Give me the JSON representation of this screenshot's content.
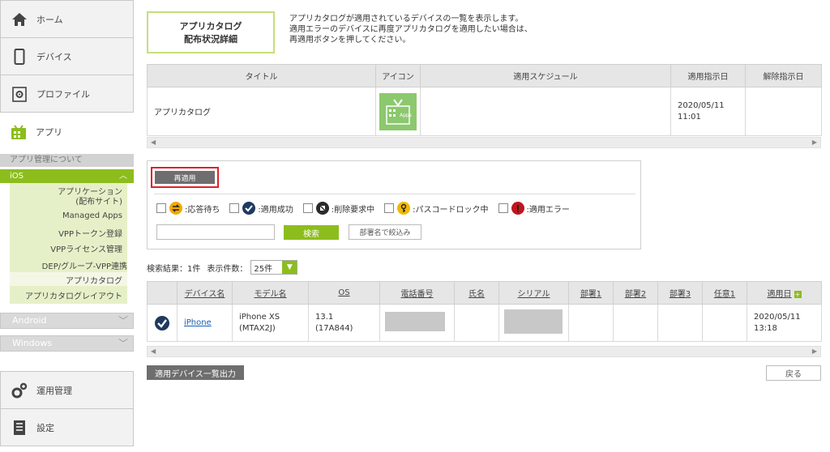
{
  "sidebar": {
    "home": "ホーム",
    "device": "デバイス",
    "profile": "プロファイル",
    "app": "アプリ",
    "about": "アプリ管理について",
    "ios": "iOS",
    "sub_items": [
      "アプリケーション",
      "(配布サイト)",
      "Managed Apps",
      "VPPトークン登録",
      "VPPライセンス管理",
      "DEP/グループ-VPP連携",
      "アプリカタログ",
      "アプリカタログレイアウト"
    ],
    "android": "Android",
    "windows": "Windows",
    "operation": "運用管理",
    "settings": "設定"
  },
  "page": {
    "title_line1": "アプリカタログ",
    "title_line2": "配布状況詳細",
    "desc_lines": [
      "アプリカタログが適用されているデバイスの一覧を表示します。",
      "適用エラーのデバイスに再度アプリカタログを適用したい場合は、",
      "再適用ボタンを押してください。"
    ]
  },
  "catalog_table": {
    "headers": [
      "タイトル",
      "アイコン",
      "適用スケジュール",
      "適用指示日",
      "解除指示日"
    ],
    "row": {
      "title": "アプリカタログ",
      "icon_text": "Apps",
      "schedule": "",
      "apply_date": "2020/05/11",
      "apply_time": "11:01",
      "cancel_date": ""
    }
  },
  "filter": {
    "reapply": "再適用",
    "statuses": [
      {
        "label": ":応答待ち",
        "color": "#f2a900"
      },
      {
        "label": ":適用成功",
        "color": "#1f3a5f"
      },
      {
        "label": ":削除要求中",
        "color": "#2b2b2b"
      },
      {
        "label": ":パスコードロック中",
        "color": "#f2b800"
      },
      {
        "label": ":適用エラー",
        "color": "#c0161d"
      }
    ],
    "search": "検索",
    "dept": "部署名で絞込み"
  },
  "results": {
    "label": "検索結果：1件",
    "per_label": "表示件数：",
    "per_value": "25件"
  },
  "device_table": {
    "headers": [
      "デバイス名",
      "モデル名",
      "OS",
      "電話番号",
      "氏名",
      "シリアル",
      "部署1",
      "部署2",
      "部署3",
      "任意1",
      "適用日"
    ],
    "row": {
      "device": "iPhone",
      "model": "iPhone XS (MTAX2J)",
      "os": "13.1 (17A844)",
      "name": "",
      "apply_date": "2020/05/11",
      "apply_time": "13:18"
    }
  },
  "footer": {
    "export": "適用デバイス一覧出力",
    "back": "戻る"
  },
  "colors": {
    "accent": "#8cbd1d",
    "reapply_highlight": "#e0202a"
  }
}
